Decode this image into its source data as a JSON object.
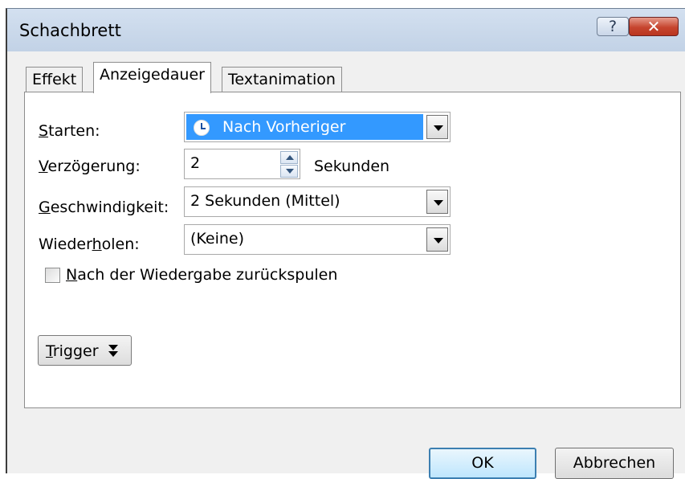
{
  "window": {
    "title": "Schachbrett",
    "help_label": "?",
    "close_label": "✕"
  },
  "tabs": [
    {
      "label": "Effekt"
    },
    {
      "label": "Anzeigedauer"
    },
    {
      "label": "Textanimation"
    }
  ],
  "form": {
    "start": {
      "label_ul": "S",
      "label_rest": "tarten:",
      "value": "Nach Vorheriger"
    },
    "delay": {
      "label_ul": "V",
      "label_rest": "erzögerung:",
      "value": "2",
      "unit": "Sekunden"
    },
    "speed": {
      "label_ul": "G",
      "label_rest": "eschwindigkeit:",
      "value": "2 Sekunden (Mittel)"
    },
    "repeat": {
      "label_pre": "Wieder",
      "label_ul": "h",
      "label_rest": "olen:",
      "value": "(Keine)"
    },
    "rewind": {
      "label_ul": "N",
      "label_rest": "ach der Wiedergabe zurückspulen",
      "checked": false
    }
  },
  "trigger": {
    "label_ul": "T",
    "label_rest": "rigger"
  },
  "buttons": {
    "ok": "OK",
    "cancel": "Abbrechen"
  },
  "colors": {
    "selection": "#3399ff",
    "titlebar": "#c4d3e6"
  }
}
